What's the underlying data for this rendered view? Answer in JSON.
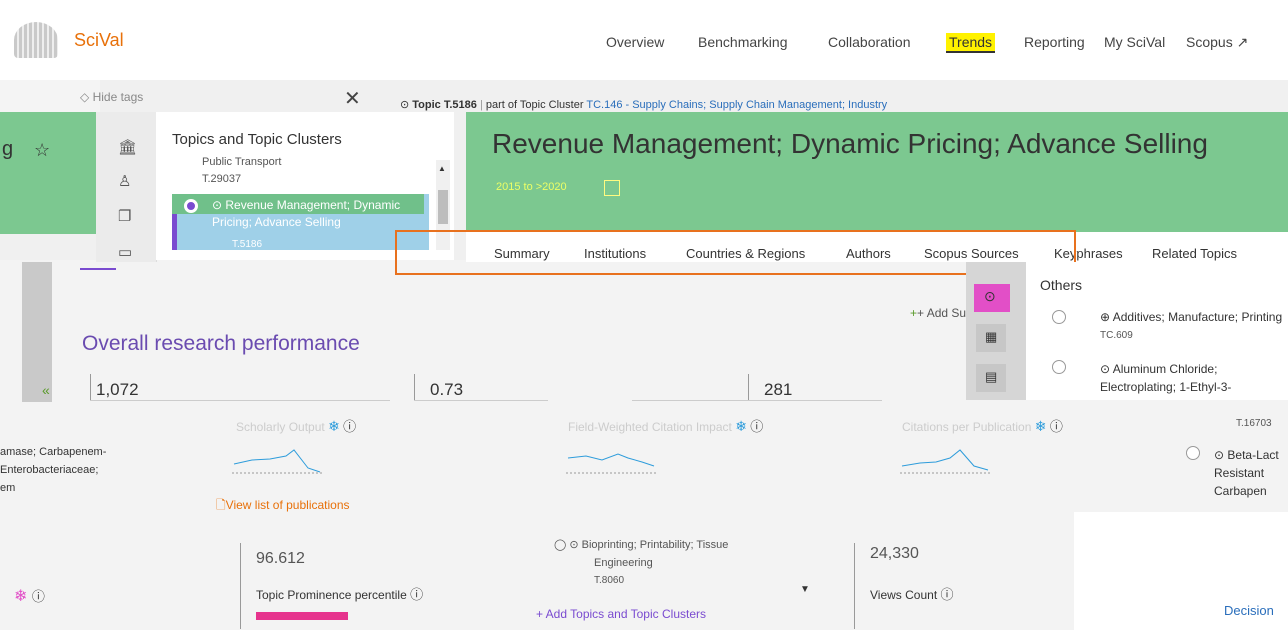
{
  "brand": {
    "name": "SciVal",
    "accent": "#e8710a"
  },
  "nav": {
    "overview": "Overview",
    "benchmarking": "Benchmarking",
    "collaboration": "Collaboration",
    "trends": "Trends",
    "reporting": "Reporting",
    "my_scival": "My SciVal",
    "scopus": "Scopus ↗"
  },
  "left_panel": {
    "hide_tags": "Hide tags",
    "close": "✕",
    "title": "Topics and Topic Clusters",
    "prev_item_label": "Public Transport",
    "prev_item_id": "T.29037",
    "selected_item_label": "Revenue Management; Dynamic Pricing; Advance Selling",
    "selected_item_id": "T.5186",
    "icons": [
      "institution-icon",
      "person-icon",
      "document-icon",
      "folder-icon"
    ]
  },
  "topic": {
    "breadcrumb_prefix": "Topic T.5186",
    "breadcrumb_mid": "part of Topic Cluster",
    "cluster_link": "TC.146 - Supply Chains; Supply Chain Management; Industry",
    "title": "Revenue Management; Dynamic Pricing; Advance Selling",
    "year_range": "2015 to >2020",
    "color": "#7cc890"
  },
  "tabs": [
    "Summary",
    "Institutions",
    "Countries & Regions",
    "Authors",
    "Scopus Sources",
    "Keyphrases",
    "Related Topics"
  ],
  "overview": {
    "title": "Overall research performance",
    "metrics": [
      {
        "value": "1,072",
        "label": "Scholarly Output"
      },
      {
        "value": "0.73",
        "label": "Field-Weighted Citation Impact"
      },
      {
        "value": "281",
        "label": "Citations per Publication"
      }
    ],
    "view_publications": "View list of publications",
    "left_fragment": [
      "amase; Carbapenem-",
      "Enterobacteriaceae;",
      "em"
    ]
  },
  "prominence": {
    "value": "96.612",
    "label": "Topic Prominence percentile",
    "percentile": 96.612,
    "bar_color": "#e6338d"
  },
  "views": {
    "value": "24,330",
    "label": "Views Count"
  },
  "dropdown_item": {
    "label_line1": "Bioprinting; Printability; Tissue",
    "label_line2": "Engineering",
    "id": "T.8060",
    "add_label": "+ Add Topics and Topic Clusters"
  },
  "popup": {
    "others": "Others",
    "add": "+ Add Su",
    "options": [
      {
        "label": "Additives; Manufacture; Printing",
        "id": "TC.609"
      },
      {
        "label": "Aluminum Chloride; Electroplating; 1-Ethyl-3-",
        "id": ""
      },
      {
        "label": "Beta-Lact Resistant Carbapen",
        "id": "T.16703"
      }
    ]
  },
  "decision": "Decision"
}
